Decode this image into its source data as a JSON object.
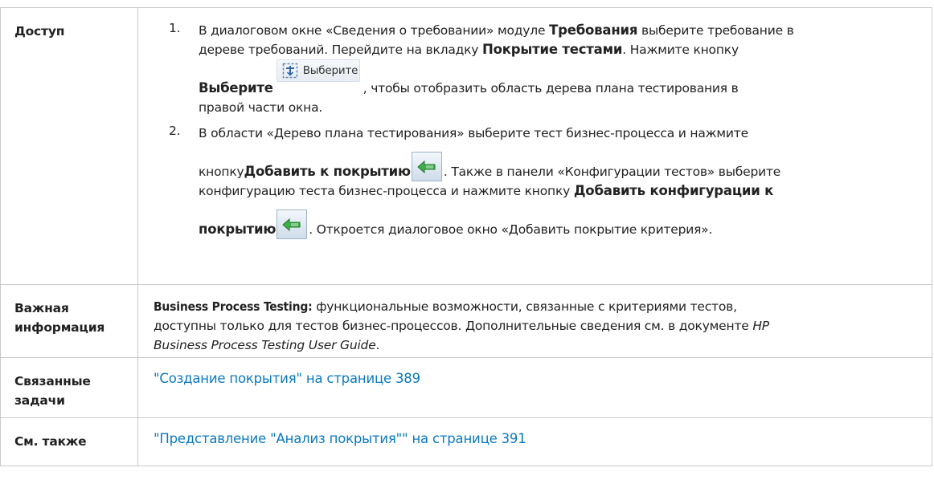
{
  "rows": {
    "access": {
      "label": "Доступ",
      "step1": {
        "num": "1.",
        "line1_a": "В диалоговом окне «Сведения о требовании» модуле ",
        "line1_b": "Требования",
        "line1_c": " выберите требование в",
        "line2_a": "дереве требований. Перейдите на вкладку ",
        "line2_b": "Покрытие тестами",
        "line2_c": ". Нажмите кнопку",
        "line3_a": "Выберите",
        "select_button_label": "Выберите",
        "line3_c": ", чтобы отобразить область дерева плана тестирования в",
        "line4": "правой части окна."
      },
      "step2": {
        "num": "2.",
        "line1": "В области «Дерево плана тестирования» выберите тест бизнес-процесса и нажмите",
        "line2_a": "кнопку ",
        "line2_b": "Добавить к покрытию",
        "line2_c": ". Также в панели «Конфигурации тестов» выберите",
        "line3_a": "конфигурацию теста бизнес-процесса и нажмите кнопку ",
        "line3_b": "Добавить конфигурации к",
        "line4_a": "покрытию",
        "line4_c": ". Откроется диалоговое окно «Добавить покрытие критерия»."
      }
    },
    "important": {
      "label": "Важная информация",
      "line1_a": "Business Process Testing:",
      "line1_b": " функциональные возможности, связанные с критериями тестов,",
      "line2_a": "доступны только для тестов бизнес-процессов. Дополнительные сведения см. в документе ",
      "line2_b": "HP",
      "line3_a": "Business Process Testing User Guide",
      "line3_b": "."
    },
    "related": {
      "label": "Связанные задачи",
      "link": "\"Создание покрытия\" на странице 389"
    },
    "see_also": {
      "label": "См. также",
      "link": "\"Представление \"Анализ покрытия\"\" на странице 391"
    }
  },
  "icons": {
    "select": "select-tree-icon",
    "add_coverage": "add-to-coverage-arrow-icon",
    "arrow_color": "#2c9a3a"
  }
}
